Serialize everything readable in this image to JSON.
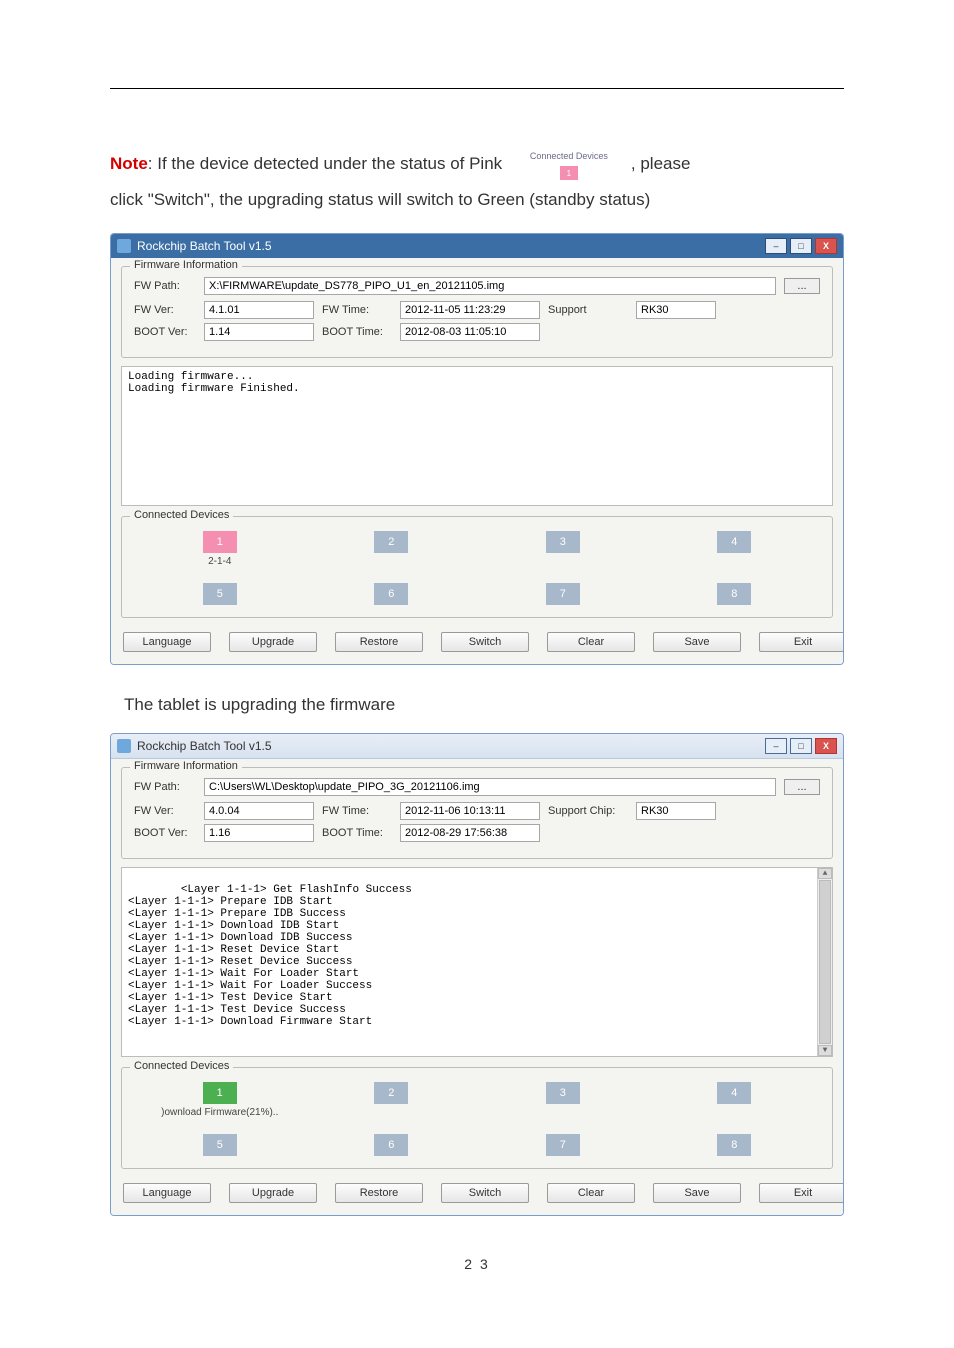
{
  "intro": {
    "note_label": "Note",
    "line1_a": ": If the device detected under the status of Pink",
    "line1_b": ", please",
    "line2": "click \"Switch\", the upgrading status will switch to Green (standby status)",
    "thumb_label": "Connected Devices",
    "thumb_slot": "1"
  },
  "win1": {
    "title": "Rockchip Batch Tool v1.5",
    "minimize": "–",
    "maximize": "□",
    "close": "X",
    "fw_legend": "Firmware Information",
    "labels": {
      "fw_path": "FW Path:",
      "fw_ver": "FW Ver:",
      "fw_time": "FW Time:",
      "boot_ver": "BOOT Ver:",
      "boot_time": "BOOT Time:",
      "support": "Support"
    },
    "values": {
      "fw_path": "X:\\FIRMWARE\\update_DS778_PIPO_U1_en_20121105.img",
      "fw_ver": "4.1.01",
      "fw_time": "2012-11-05 11:23:29",
      "boot_ver": "1.14",
      "boot_time": "2012-08-03 11:05:10",
      "chip": "RK30"
    },
    "browse": "...",
    "log": "Loading firmware...\nLoading firmware Finished.",
    "devices_legend": "Connected Devices",
    "slots": [
      "1",
      "2",
      "3",
      "4",
      "5",
      "6",
      "7",
      "8"
    ],
    "slot1_sub": "2-1-4",
    "buttons": {
      "language": "Language",
      "upgrade": "Upgrade",
      "restore": "Restore",
      "switch": "Switch",
      "clear": "Clear",
      "save": "Save",
      "exit": "Exit"
    }
  },
  "mid_text": "The tablet is upgrading the firmware",
  "win2": {
    "title": "Rockchip Batch Tool v1.5",
    "minimize": "–",
    "maximize": "□",
    "close": "X",
    "fw_legend": "Firmware Information",
    "labels": {
      "fw_path": "FW Path:",
      "fw_ver": "FW Ver:",
      "fw_time": "FW Time:",
      "boot_ver": "BOOT Ver:",
      "boot_time": "BOOT Time:",
      "support": "Support Chip:"
    },
    "values": {
      "fw_path": "C:\\Users\\WL\\Desktop\\update_PIPO_3G_20121106.img",
      "fw_ver": "4.0.04",
      "fw_time": "2012-11-06 10:13:11",
      "boot_ver": "1.16",
      "boot_time": "2012-08-29 17:56:38",
      "chip": "RK30"
    },
    "browse": "...",
    "log": "<Layer 1-1-1> Get FlashInfo Success\n<Layer 1-1-1> Prepare IDB Start\n<Layer 1-1-1> Prepare IDB Success\n<Layer 1-1-1> Download IDB Start\n<Layer 1-1-1> Download IDB Success\n<Layer 1-1-1> Reset Device Start\n<Layer 1-1-1> Reset Device Success\n<Layer 1-1-1> Wait For Loader Start\n<Layer 1-1-1> Wait For Loader Success\n<Layer 1-1-1> Test Device Start\n<Layer 1-1-1> Test Device Success\n<Layer 1-1-1> Download Firmware Start",
    "devices_legend": "Connected Devices",
    "slots": [
      "1",
      "2",
      "3",
      "4",
      "5",
      "6",
      "7",
      "8"
    ],
    "slot1_sub": ")ownload Firmware(21%)..",
    "buttons": {
      "language": "Language",
      "upgrade": "Upgrade",
      "restore": "Restore",
      "switch": "Switch",
      "clear": "Clear",
      "save": "Save",
      "exit": "Exit"
    }
  },
  "page_number": "2 3"
}
